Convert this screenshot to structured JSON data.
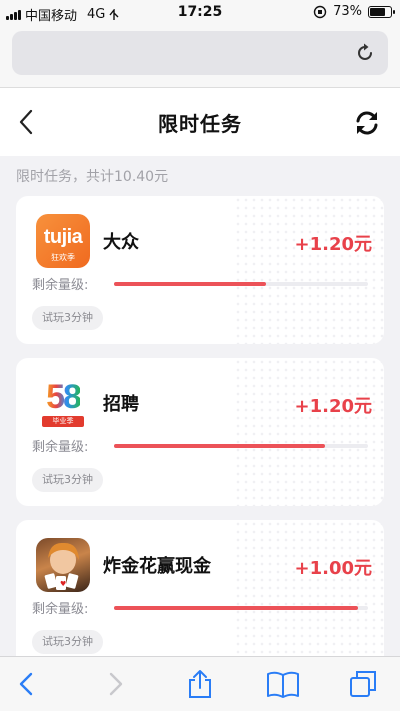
{
  "status_bar": {
    "carrier": "中国移动",
    "network": "4G",
    "time": "17:25",
    "battery": "73%",
    "battery_level": 0.73
  },
  "browser": {
    "address": ""
  },
  "header": {
    "title": "限时任务"
  },
  "summary": "限时任务，共计10.40元",
  "tasks": [
    {
      "name": "大众",
      "reward": "+1.20元",
      "remain_label": "剩余量级:",
      "remain_level": 0.6,
      "tag": "试玩3分钟",
      "icon_text": "tujia",
      "icon_subtext": "狂欢季"
    },
    {
      "name": "招聘",
      "reward": "+1.20元",
      "remain_label": "剩余量级:",
      "remain_level": 0.83,
      "tag": "试玩3分钟",
      "icon_text": "58",
      "icon_subtext": "毕业季"
    },
    {
      "name": "炸金花赢现金",
      "reward": "+1.00元",
      "remain_label": "剩余量级:",
      "remain_level": 0.96,
      "tag": "试玩3分钟",
      "icon_text": "",
      "icon_subtext": ""
    }
  ],
  "colors": {
    "accent": "#e8414a",
    "progress": "#ec5258",
    "ios_blue": "#2a7df6"
  }
}
